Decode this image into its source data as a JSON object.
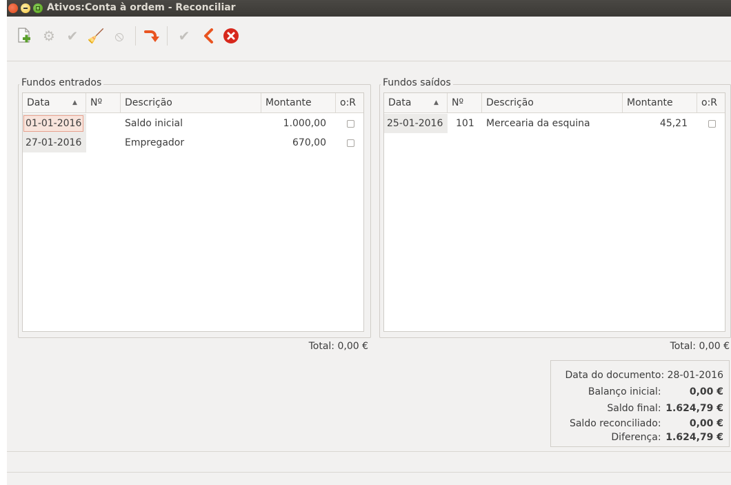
{
  "window": {
    "title": "Ativos:Conta à ordem - Reconciliar"
  },
  "toolbar": {
    "icons": [
      "new-icon",
      "settings-icon",
      "check-icon",
      "brush-icon",
      "cancel-icon",
      "transfer-icon",
      "check-icon",
      "back-icon",
      "close-icon"
    ]
  },
  "debits": {
    "title": "Fundos entrados",
    "columns": [
      "Data",
      "Nº",
      "Descrição",
      "Montante",
      "o:R"
    ],
    "rows": [
      {
        "date": "01-01-2016",
        "num": "",
        "desc": "Saldo inicial",
        "amount": "1.000,00"
      },
      {
        "date": "27-01-2016",
        "num": "",
        "desc": "Empregador",
        "amount": "670,00"
      }
    ],
    "total_label": "Total:",
    "total_value": "0,00 €"
  },
  "credits": {
    "title": "Fundos saídos",
    "columns": [
      "Data",
      "Nº",
      "Descrição",
      "Montante",
      "o:R"
    ],
    "rows": [
      {
        "date": "25-01-2016",
        "num": "101",
        "desc": "Mercearia da esquina",
        "amount": "45,21"
      }
    ],
    "total_label": "Total:",
    "total_value": "0,00 €"
  },
  "summary": {
    "statement_date_label": "Data do documento:",
    "statement_date": "28-01-2016",
    "starting_label": "Balanço inicial:",
    "starting_value": "0,00 €",
    "ending_label": "Saldo final:",
    "ending_value": "1.624,79 €",
    "reconciled_label": "Saldo reconciliado:",
    "reconciled_value": "0,00 €",
    "difference_label": "Diferença:",
    "difference_value": "1.624,79 €"
  },
  "colors": {
    "titlebar": "#3b3935",
    "close": "#df4a16",
    "accent": "#e95420"
  }
}
